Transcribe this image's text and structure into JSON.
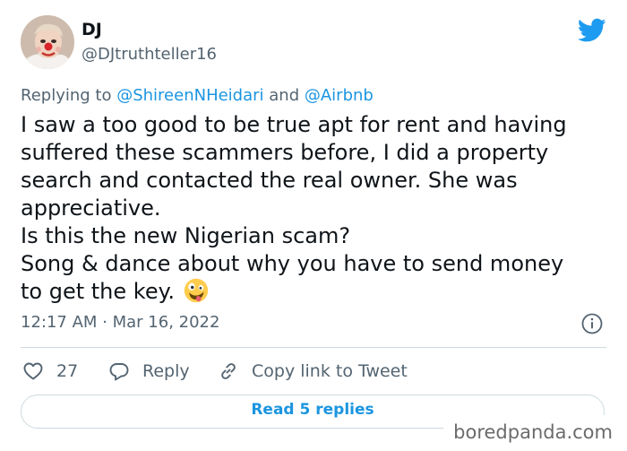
{
  "author": {
    "display_name": "DJ",
    "handle": "@DJtruthteller16"
  },
  "reply_to": {
    "prefix": "Replying to ",
    "mention1": "@ShireenNHeidari",
    "conjunction": " and ",
    "mention2": "@Airbnb"
  },
  "tweet": {
    "lines": [
      "I saw a too good to be true apt for rent and having",
      "suffered these scammers before, I did a property",
      "search and contacted the real owner. She was",
      "appreciative.",
      "Is this the new Nigerian scam?",
      "Song & dance about why you have to send money",
      "to get the key."
    ],
    "emoji": "zany-face-emoji"
  },
  "timestamp": "12:17 AM · Mar 16, 2022",
  "actions": {
    "like_count": "27",
    "reply_label": "Reply",
    "copy_label": "Copy link to Tweet"
  },
  "read_replies_label": "Read 5 replies",
  "watermark": "boredpanda.com",
  "colors": {
    "accent": "#1d9bf0",
    "link": "#1b95e0",
    "text": "#0f1419",
    "muted": "#536471",
    "border": "#cfd9de"
  },
  "icons": [
    "twitter-bird-icon",
    "info-icon",
    "heart-icon",
    "reply-bubble-icon",
    "link-icon"
  ]
}
